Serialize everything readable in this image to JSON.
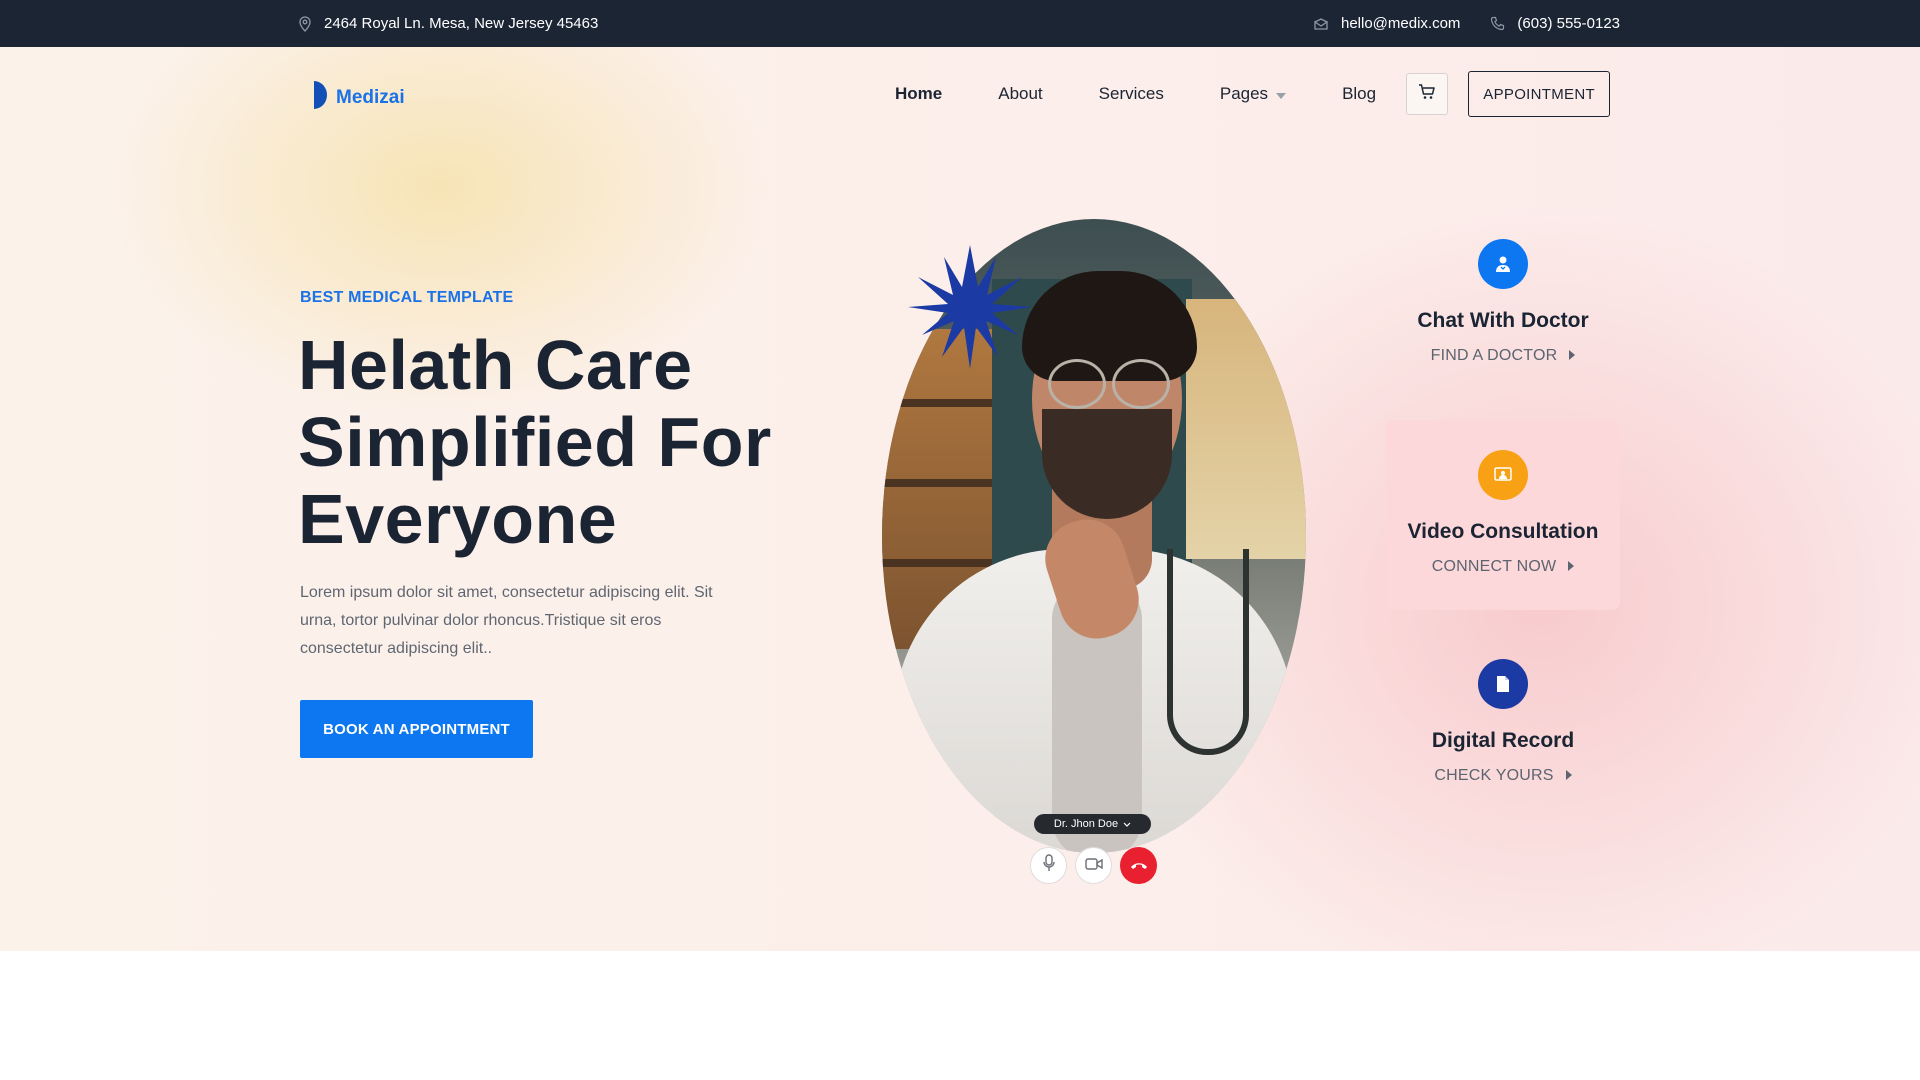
{
  "topbar": {
    "address": "2464 Royal Ln. Mesa, New Jersey 45463",
    "email": "hello@medix.com",
    "phone": "(603) 555-0123"
  },
  "brand": {
    "name": "Medizai",
    "color": "#1b72e8"
  },
  "nav": {
    "items": [
      {
        "label": "Home",
        "active": true
      },
      {
        "label": "About"
      },
      {
        "label": "Services"
      },
      {
        "label": "Pages",
        "has_dropdown": true
      },
      {
        "label": "Blog"
      }
    ],
    "cart_icon": "cart-icon",
    "appointment_label": "APPOINTMENT"
  },
  "hero": {
    "tagline": "BEST MEDICAL TEMPLATE",
    "headline": [
      "Helath Care",
      "Simplified For",
      "Everyone"
    ],
    "description": "Lorem ipsum dolor sit amet, consectetur adipiscing elit. Sit urna, tortor pulvinar dolor rhoncus.Tristique sit eros consectetur adipiscing elit..",
    "cta_label": "BOOK AN APPOINTMENT",
    "cta_color": "#0c77f0"
  },
  "video_call": {
    "caller_name": "Dr. Jhon Doe",
    "controls": [
      "microphone-icon",
      "video-camera-icon",
      "hang-up-icon"
    ]
  },
  "features": [
    {
      "title": "Chat With Doctor",
      "link": "FIND A DOCTOR",
      "icon": "doctor-icon",
      "color": "#0c77f0",
      "active": false
    },
    {
      "title": "Video Consultation",
      "link": "CONNECT NOW",
      "icon": "video-consult-icon",
      "color": "#f9a114",
      "active": true
    },
    {
      "title": "Digital Record",
      "link": "CHECK YOURS",
      "icon": "document-icon",
      "color": "#1c3aa3",
      "active": false
    }
  ]
}
